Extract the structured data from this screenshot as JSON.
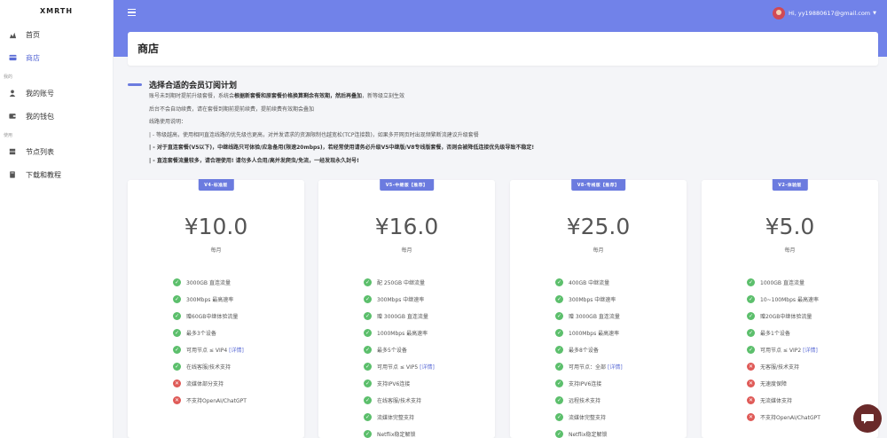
{
  "brand": "XMRTH",
  "sidebar": {
    "items": [
      {
        "label": "首页",
        "icon": "dashboard-icon",
        "active": false
      },
      {
        "label": "商店",
        "icon": "shop-icon",
        "active": true
      }
    ],
    "section1": "我的",
    "items2": [
      {
        "label": "我的账号",
        "icon": "user-icon"
      },
      {
        "label": "我的钱包",
        "icon": "wallet-icon"
      }
    ],
    "section2": "使用",
    "items3": [
      {
        "label": "节点列表",
        "icon": "server-icon"
      },
      {
        "label": "下载和教程",
        "icon": "book-icon"
      }
    ]
  },
  "header": {
    "user_label": "Hi, yy19880617@gmail.com"
  },
  "page_title": "商店",
  "info": {
    "heading": "选择合适的会员订阅计划",
    "line1_a": "账号未到期时提前升级套餐，系统会",
    "line1_b": "根据新套餐和原套餐价格换算剩余有效期，然后再叠加",
    "line1_c": "，新等级立刻生效",
    "line2": "后台不会自动续费，请在套餐到期前提前续费，提前续费有效期会叠加",
    "line3": "线路使用说明：",
    "line4": "| - 等级越高，使用相同直连线路的优先级也更高，对并发请求的资源限制也越宽松(TCP连接数)，如果多开网页时出现频繁断流建议升级套餐",
    "line5": "| - 对于直连套餐(V5以下)，中继线路只可体验/应急备用(限速20mbps)，若经常使用请务必升级V5中继版/V8专线版套餐，否则会被降低连接优先级导致不稳定!",
    "line6": "| - 直连套餐流量较多，请合理使用! 请勿多人合用/高并发爬虫/免流，一经发现永久封号!"
  },
  "plans": [
    {
      "badge": "V4-标准版",
      "price": "¥10.0",
      "period": "每月",
      "features": [
        {
          "text": "3000GB 直连流量",
          "ok": true
        },
        {
          "text": "300Mbps 最高速率",
          "ok": true
        },
        {
          "text": "赠60GB中继体验流量",
          "ok": true
        },
        {
          "text": "最多3个设备",
          "ok": true
        },
        {
          "text": "可用节点 ≤ VIP4",
          "link": "[详情]",
          "ok": true
        },
        {
          "text": "在线客服/技术支持",
          "ok": true
        },
        {
          "text": "流媒体部分支持",
          "ok": false
        },
        {
          "text": "不支持OpenAI/ChatGPT",
          "ok": false
        }
      ]
    },
    {
      "badge": "V5-中继版【推荐】",
      "price": "¥16.0",
      "period": "每月",
      "features": [
        {
          "text": "配 250GB 中继流量",
          "ok": true
        },
        {
          "text": "300Mbps 中继速率",
          "ok": true
        },
        {
          "text": "赠 3000GB 直连流量",
          "ok": true
        },
        {
          "text": "1000Mbps 最高速率",
          "ok": true
        },
        {
          "text": "最多5个设备",
          "ok": true
        },
        {
          "text": "可用节点 ≤ VIP5",
          "link": "[详情]",
          "ok": true
        },
        {
          "text": "支持IPV6连接",
          "ok": true
        },
        {
          "text": "在线客服/技术支持",
          "ok": true
        },
        {
          "text": "流媒体完整支持",
          "ok": true
        },
        {
          "text": "Netflix稳定解锁",
          "ok": true
        }
      ]
    },
    {
      "badge": "V8-专线版【推荐】",
      "price": "¥25.0",
      "period": "每月",
      "features": [
        {
          "text": "400GB 中继流量",
          "ok": true
        },
        {
          "text": "300Mbps 中继速率",
          "ok": true
        },
        {
          "text": "赠 3000GB 直连流量",
          "ok": true
        },
        {
          "text": "1000Mbps 最高速率",
          "ok": true
        },
        {
          "text": "最多8个设备",
          "ok": true
        },
        {
          "text": "可用节点：全部",
          "link": "[详情]",
          "ok": true
        },
        {
          "text": "支持IPV6连接",
          "ok": true
        },
        {
          "text": "远程技术支持",
          "ok": true
        },
        {
          "text": "流媒体完整支持",
          "ok": true
        },
        {
          "text": "Netflix稳定解锁",
          "ok": true
        }
      ]
    },
    {
      "badge": "V2-体验版",
      "price": "¥5.0",
      "period": "每月",
      "features": [
        {
          "text": "1000GB 直连流量",
          "ok": true
        },
        {
          "text": "10~100Mbps 最高速率",
          "ok": true
        },
        {
          "text": "赠20GB中继体验流量",
          "ok": true
        },
        {
          "text": "最多1个设备",
          "ok": true
        },
        {
          "text": "可用节点 ≤ VIP2",
          "link": "[详情]",
          "ok": true
        },
        {
          "text": "无客服/技术支持",
          "ok": false
        },
        {
          "text": "无速度保障",
          "ok": false
        },
        {
          "text": "无流媒体支持",
          "ok": false
        },
        {
          "text": "不支持OpenAI/ChatGPT",
          "ok": false
        }
      ]
    }
  ],
  "colors": {
    "accent": "#7182e9",
    "ok": "#5cbf6c",
    "no": "#df5a57"
  }
}
